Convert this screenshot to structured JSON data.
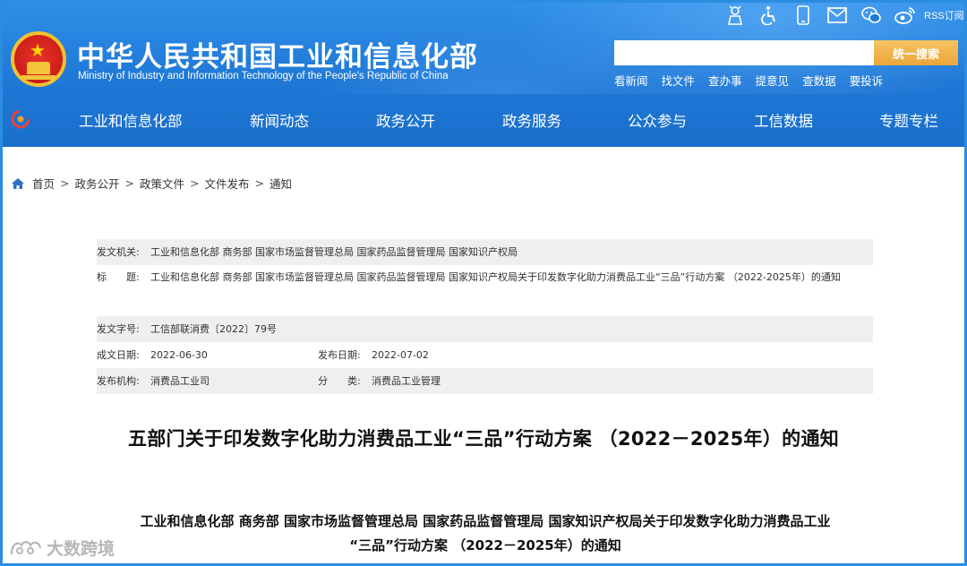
{
  "header": {
    "title_cn": "中华人民共和国工业和信息化部",
    "title_en": "Ministry of Industry and Information Technology of the People's Republic of China",
    "rss_label": "RSS订阅",
    "search_placeholder": "",
    "search_button": "统一搜索",
    "quick_links": [
      "看新闻",
      "找文件",
      "查办事",
      "提意见",
      "查数据",
      "要投诉"
    ],
    "top_icons": [
      "elderly-mode-icon",
      "accessibility-icon",
      "mobile-icon",
      "mail-icon",
      "wechat-icon",
      "weibo-icon"
    ]
  },
  "nav": {
    "items": [
      "工业和信息化部",
      "新闻动态",
      "政务公开",
      "政务服务",
      "公众参与",
      "工信数据",
      "专题专栏"
    ]
  },
  "breadcrumb": {
    "items": [
      "首页",
      "政务公开",
      "政策文件",
      "文件发布",
      "通知"
    ],
    "separator": ">"
  },
  "meta": {
    "issuer_label": "发文机关:",
    "issuer_value": "工业和信息化部 商务部 国家市场监督管理总局 国家药品监督管理局 国家知识产权局",
    "title_label": "标　　题:",
    "title_value": "工业和信息化部 商务部 国家市场监督管理总局 国家药品监督管理局 国家知识产权局关于印发数字化助力消费品工业“三品”行动方案 （2022-2025年）的通知",
    "doc_no_label": "发文字号:",
    "doc_no_value": "工信部联消费〔2022〕79号",
    "written_label": "成文日期:",
    "written_value": "2022-06-30",
    "published_label": "发布日期:",
    "published_value": "2022-07-02",
    "org_label": "发布机构:",
    "org_value": "消费品工业司",
    "category_label": "分　　类:",
    "category_value": "消费品工业管理"
  },
  "document": {
    "title": "五部门关于印发数字化助力消费品工业“三品”行动方案 （2022－2025年）的通知",
    "subtitle_line1": "工业和信息化部 商务部 国家市场监督管理总局 国家药品监督管理局 国家知识产权局关于印发数字化助力消费品工业",
    "subtitle_line2": "“三品”行动方案 （2022－2025年）的通知"
  },
  "watermark": {
    "text": "大数跨境"
  },
  "colors": {
    "header_blue": "#1f78d6",
    "search_button": "#eaa53a",
    "meta_shade": "#efefef",
    "frame": "#2a8de0"
  }
}
